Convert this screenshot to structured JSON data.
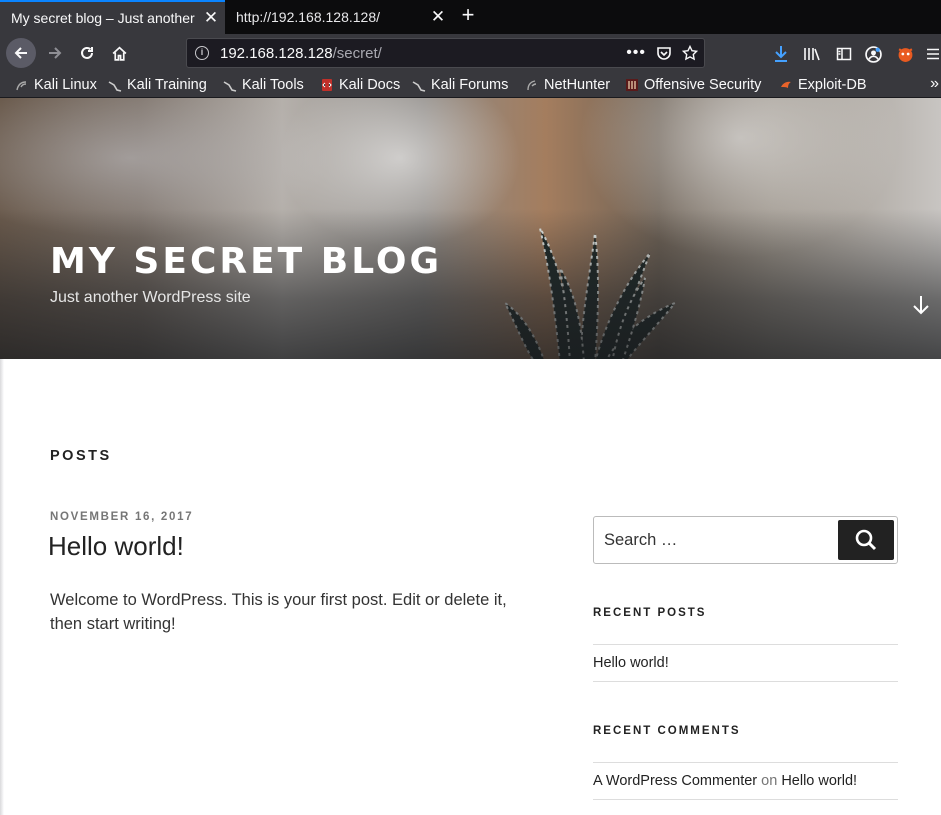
{
  "browser": {
    "tabs": [
      {
        "title": "My secret blog – Just another WordPress site",
        "active": true
      },
      {
        "title": "http://192.168.128.128/",
        "active": false
      }
    ],
    "url": {
      "host": "192.168.128.128",
      "path": "/secret/"
    },
    "bookmarks": [
      "Kali Linux",
      "Kali Training",
      "Kali Tools",
      "Kali Docs",
      "Kali Forums",
      "NetHunter",
      "Offensive Security",
      "Exploit-DB"
    ],
    "accent": "#0a84ff"
  },
  "site": {
    "title": "MY SECRET BLOG",
    "tagline": "Just another WordPress site"
  },
  "main": {
    "heading": "POSTS",
    "post": {
      "date": "NOVEMBER 16, 2017",
      "title": "Hello world!",
      "excerpt": "Welcome to WordPress. This is your first post. Edit or delete it, then start writing!"
    }
  },
  "sidebar": {
    "search_placeholder": "Search …",
    "recent_posts_title": "RECENT POSTS",
    "recent_posts": [
      "Hello world!"
    ],
    "recent_comments_title": "RECENT COMMENTS",
    "recent_comment": {
      "author": "A WordPress Commenter",
      "on": "on",
      "post": "Hello world!"
    }
  }
}
